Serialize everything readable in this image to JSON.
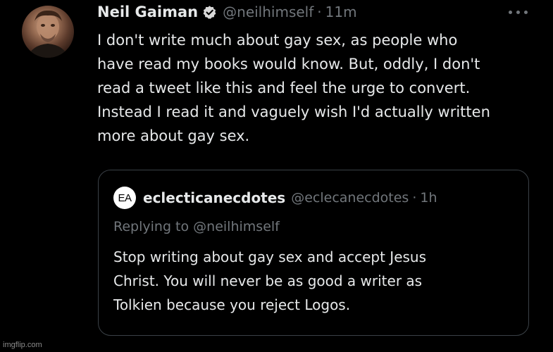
{
  "tweet": {
    "author_name": "Neil Gaiman",
    "author_handle": "@neilhimself",
    "separator": "·",
    "time": "11m",
    "verified": true,
    "avatar_icon": "author-portrait",
    "more_icon": "more-options-icon",
    "body_lines": [
      "I don't write much about gay sex, as people who",
      "have read my books would know. But, oddly, I don't",
      "read a tweet like this and feel the urge to convert.",
      "Instead I read it and vaguely wish I'd actually written",
      "more about gay sex."
    ]
  },
  "quote": {
    "avatar_text": "EA",
    "author_name": "eclecticanecdotes",
    "author_handle": "@eclecanecdotes",
    "separator": "·",
    "time": "1h",
    "replying_prefix": "Replying to",
    "replying_handle": "@neilhimself",
    "body_lines": [
      "Stop writing about gay sex and accept Jesus",
      "Christ. You will never be as good a writer as",
      "Tolkien because you reject Logos."
    ]
  },
  "watermark": "imgflip.com",
  "colors": {
    "background": "#000000",
    "text_primary": "#e7e9ea",
    "text_secondary": "#71767b",
    "border": "#3b4147",
    "verified_badge": "#d9d9d9"
  }
}
